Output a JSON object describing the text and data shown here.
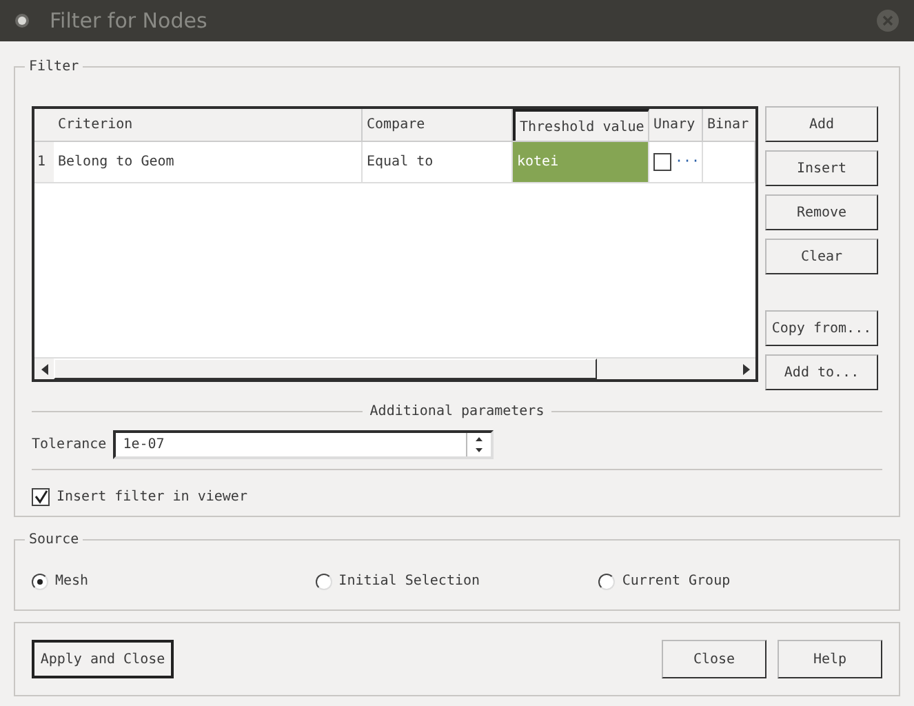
{
  "window": {
    "title": "Filter for Nodes"
  },
  "filter": {
    "title": "Filter",
    "columns": [
      "Criterion",
      "Compare",
      "Threshold value",
      "Unary",
      "Binar"
    ],
    "rows": [
      {
        "number": "1",
        "criterion": "Belong to Geom",
        "compare": "Equal to",
        "threshold": "kotei",
        "threshold_selected": true,
        "unary_checked": false,
        "unary_more": "···"
      }
    ],
    "buttons": [
      "Add",
      "Insert",
      "Remove",
      "Clear",
      "Copy from...",
      "Add to..."
    ],
    "additional_title": "Additional parameters",
    "tolerance": {
      "label": "Tolerance",
      "value": "1e-07"
    },
    "insert_in_viewer": {
      "label": "Insert filter in viewer",
      "checked": true
    }
  },
  "source": {
    "title": "Source",
    "options": [
      {
        "label": "Mesh",
        "selected": true
      },
      {
        "label": "Initial Selection",
        "selected": false
      },
      {
        "label": "Current Group",
        "selected": false
      }
    ]
  },
  "footer": {
    "buttons": [
      {
        "label": "Apply and Close",
        "default": true
      },
      {
        "label": "Close",
        "default": false
      },
      {
        "label": "Help",
        "default": false
      }
    ]
  }
}
